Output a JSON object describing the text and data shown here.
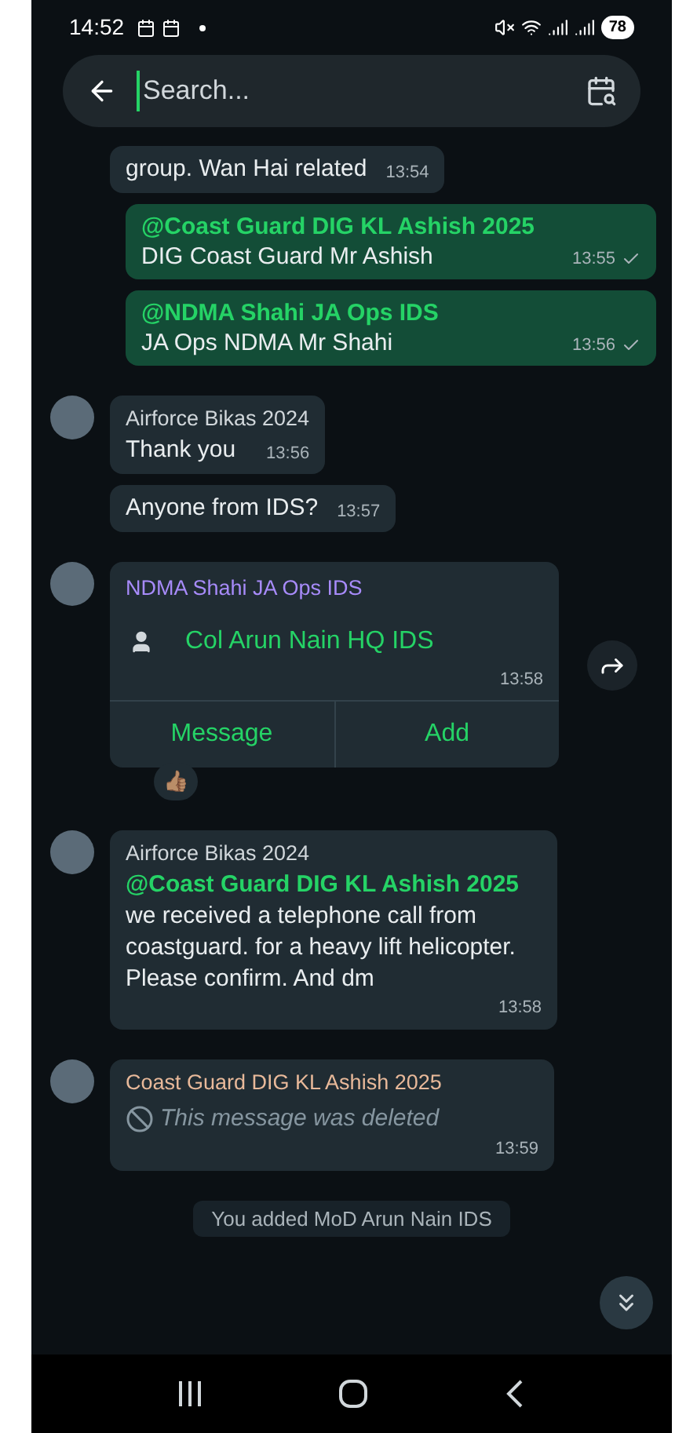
{
  "status_bar": {
    "time": "14:52",
    "battery": "78"
  },
  "search": {
    "placeholder": "Search..."
  },
  "messages": [
    {
      "kind": "incoming",
      "tail": false,
      "text": "group. Wan Hai related",
      "time": "13:54"
    },
    {
      "kind": "outgoing",
      "mention": "@Coast Guard DIG KL Ashish 2025",
      "text": "DIG Coast Guard Mr Ashish",
      "time": "13:55",
      "sent": true
    },
    {
      "kind": "outgoing",
      "mention": "@NDMA Shahi JA Ops IDS",
      "text": "JA Ops NDMA Mr Shahi",
      "time": "13:56",
      "sent": true
    },
    {
      "kind": "incoming",
      "tail": true,
      "sender": "Airforce Bikas 2024",
      "color": "#d1d7db",
      "text": "Thank you",
      "time": "13:56"
    },
    {
      "kind": "incoming",
      "tail": false,
      "text": "Anyone from IDS?",
      "time": "13:57"
    },
    {
      "kind": "contact",
      "sender": "NDMA Shahi JA Ops IDS",
      "color": "#a78bfa",
      "contact_name": "Col Arun Nain HQ IDS",
      "time": "13:58",
      "actions": [
        "Message",
        "Add"
      ],
      "reaction": "👍🏽"
    },
    {
      "kind": "incoming",
      "tail": true,
      "sender": "Airforce Bikas 2024",
      "color": "#d1d7db",
      "mention": "@Coast Guard DIG KL Ashish 2025",
      "text": "we received a telephone call from coastguard. for a heavy lift  helicopter. Please confirm. And dm",
      "time": "13:58"
    },
    {
      "kind": "deleted",
      "sender": "Coast Guard DIG KL Ashish 2025",
      "color": "#e8b99a",
      "text": "This message was deleted",
      "time": "13:59"
    },
    {
      "kind": "system",
      "text": "You added MoD Arun Nain IDS"
    }
  ]
}
